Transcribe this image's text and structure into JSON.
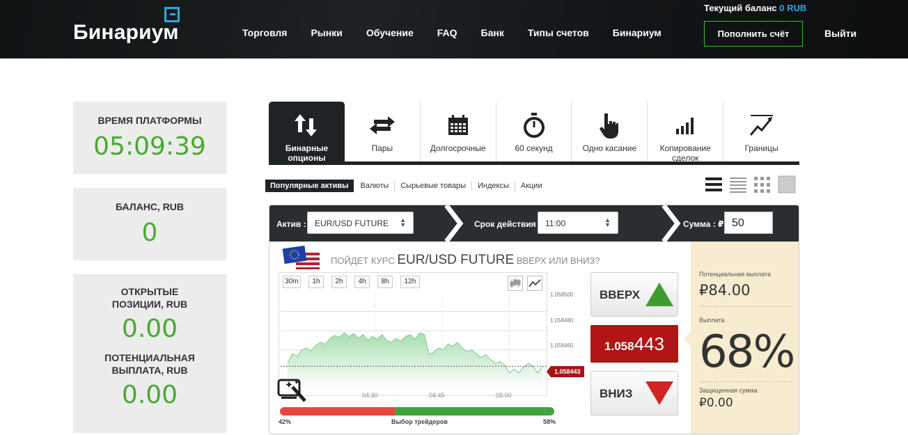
{
  "header": {
    "logo": "Бинариум",
    "nav": [
      "Торговля",
      "Рынки",
      "Обучение",
      "FAQ",
      "Банк",
      "Типы счетов",
      "Бинариум"
    ],
    "balance_label": "Текущий баланс",
    "balance_value": "0 RUB",
    "deposit_label": "Пополнить счёт",
    "logout_label": "Выйти",
    "accent_color": "#2aa8e0",
    "deposit_border_color": "#42b53c"
  },
  "sidebar": {
    "platform_time_label": "ВРЕМЯ ПЛАТФОРМЫ",
    "platform_time": "05:09:39",
    "balance_label": "БАЛАНС, RUB",
    "balance": "0",
    "open_positions_label": "ОТКРЫТЫЕ ПОЗИЦИИ, RUB",
    "open_positions": "0.00",
    "potential_payout_label": "ПОТЕНЦИАЛЬНАЯ ВЫПЛАТА, RUB",
    "potential_payout": "0.00",
    "value_color": "#4aa832"
  },
  "tabs": [
    {
      "label": "Бинарные опционы",
      "icon": "updown-arrows-icon",
      "active": true
    },
    {
      "label": "Пары",
      "icon": "swap-arrows-icon",
      "active": false
    },
    {
      "label": "Долгосрочные",
      "icon": "calendar-icon",
      "active": false
    },
    {
      "label": "60 секунд",
      "icon": "stopwatch-icon",
      "active": false
    },
    {
      "label": "Одно касание",
      "icon": "pointer-hand-icon",
      "active": false
    },
    {
      "label": "Копирование сделок",
      "icon": "bars-icon",
      "active": false
    },
    {
      "label": "Границы",
      "icon": "trend-line-icon",
      "active": false
    }
  ],
  "filters": [
    "Популярные активы",
    "Валюты",
    "Сырьевые товары",
    "Индексы",
    "Акции"
  ],
  "trade": {
    "asset_label": "Актив :",
    "asset_value": "EUR/USD FUTURE",
    "expiry_label": "Срок действия :",
    "expiry_value": "11:00",
    "amount_label": "Сумма : ₽",
    "amount_value": "50",
    "question_prefix": "ПОЙДЕТ КУРС",
    "question_asset": "EUR/USD FUTURE",
    "question_suffix": "ВВЕРХ ИЛИ ВНИЗ?",
    "timeframes": [
      "30m",
      "1h",
      "2h",
      "4h",
      "8h",
      "12h"
    ],
    "up_label": "ВВЕРХ",
    "down_label": "ВНИЗ",
    "price_small": "1.058",
    "price_big": "443",
    "price_tag": "1.058443",
    "traders_label": "Выбор трейдеров",
    "traders_down_pct": "42%",
    "traders_up_pct": "58%",
    "traders_down": 0.42,
    "traders_up": 0.58
  },
  "chart_data": {
    "type": "area",
    "y_ticks": [
      "1.058500",
      "1.058480",
      "1.058460"
    ],
    "x_ticks": [
      "04:30",
      "04:45",
      "05:00"
    ],
    "current": 1.058443,
    "series": [
      {
        "values": [
          1.058446,
          1.058456,
          1.058453,
          1.05846,
          1.058462,
          1.058459,
          1.058465,
          1.058468,
          1.058466,
          1.058472,
          1.058475,
          1.058473,
          1.058478,
          1.058474,
          1.058477,
          1.058472,
          1.058476,
          1.05847,
          1.058474,
          1.058471,
          1.058476,
          1.05847,
          1.058468,
          1.058472,
          1.058469,
          1.058474,
          1.058476,
          1.058471,
          1.058478,
          1.058476,
          1.058455,
          1.058458,
          1.058462,
          1.05846,
          1.058466,
          1.058464,
          1.058468,
          1.058462,
          1.058458,
          1.05846,
          1.058456,
          1.058452,
          1.058455,
          1.05845,
          1.058446,
          1.058448,
          1.058444,
          1.058436,
          1.05844,
          1.058436,
          1.058442,
          1.058446,
          1.058443,
          1.058436,
          1.058443
        ]
      }
    ]
  },
  "payout": {
    "potential_label": "Потенциальная выплата",
    "potential_value": "₽84.00",
    "payout_label": "Выплата",
    "payout_pct": "68%",
    "protected_label": "Защищенная сумма",
    "protected_value": "₽0.00"
  }
}
